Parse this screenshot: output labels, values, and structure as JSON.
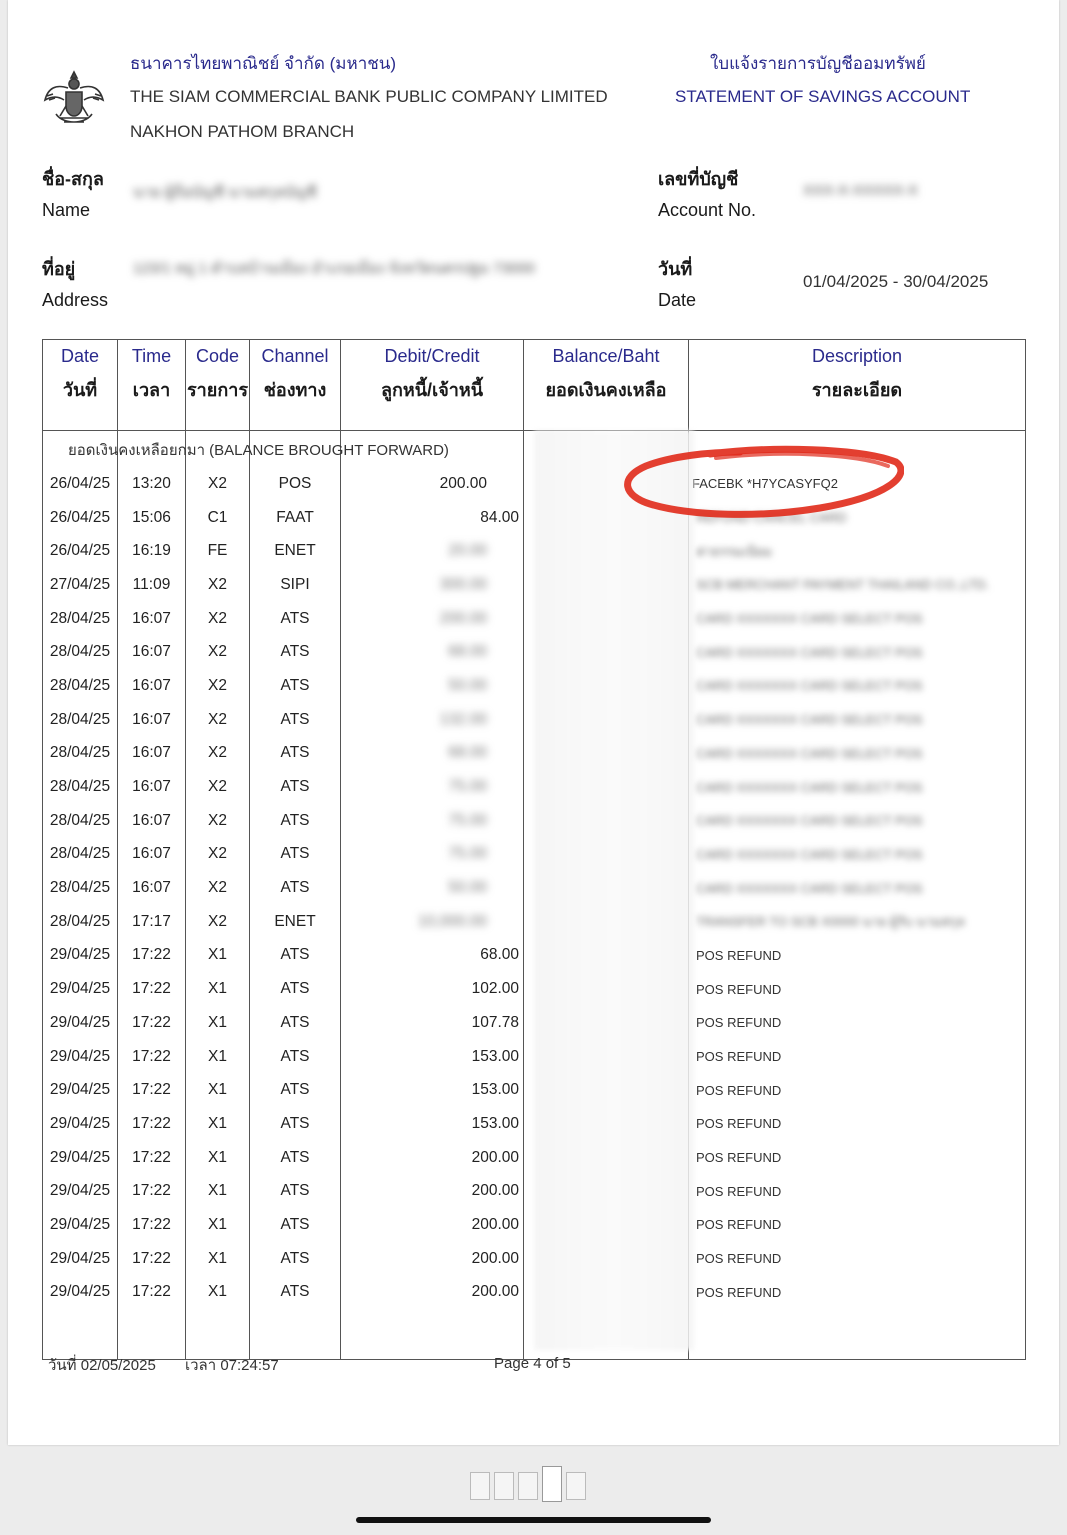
{
  "header": {
    "bank_th": "ธนาคารไทยพาณิชย์ จำกัด (มหาชน)",
    "bank_en": "THE SIAM COMMERCIAL BANK PUBLIC COMPANY LIMITED",
    "branch": "NAKHON PATHOM BRANCH",
    "doc_th": "ใบแจ้งรายการบัญชีออมทรัพย์",
    "doc_en": "STATEMENT OF SAVINGS ACCOUNT",
    "logo_icon": "garuda-emblem-icon"
  },
  "info": {
    "name_th": "ชื่อ-สกุล",
    "name_en": "Name",
    "name_value": "นาย ผู้ถือบัญชี นามสกุลบัญชี",
    "address_th": "ที่อยู่",
    "address_en": "Address",
    "address_value": "123/1 หมู่ 1 ตำบลบ้านเมือง อำเภอเมือง จังหวัดนครปฐม 73000",
    "account_th": "เลขที่บัญชี",
    "account_en": "Account No.",
    "account_value": "XXX-X-XXXXX-X",
    "date_th": "วันที่",
    "date_en": "Date",
    "date_value": "01/04/2025 - 30/04/2025"
  },
  "table": {
    "headers": [
      {
        "en": "Date",
        "th": "วันที่"
      },
      {
        "en": "Time",
        "th": "เวลา"
      },
      {
        "en": "Code",
        "th": "รายการ"
      },
      {
        "en": "Channel",
        "th": "ช่องทาง"
      },
      {
        "en": "Debit/Credit",
        "th": "ลูกหนี้/เจ้าหนี้"
      },
      {
        "en": "Balance/Baht",
        "th": "ยอดเงินคงเหลือ"
      },
      {
        "en": "Description",
        "th": "รายละเอียด"
      }
    ],
    "brought_forward": "ยอดเงินคงเหลือยกมา (BALANCE BROUGHT FORWARD)",
    "rows": [
      {
        "date": "26/04/25",
        "time": "13:20",
        "code": "X2",
        "channel": "POS",
        "amount": "200.00",
        "desc": "FACEBK *H7YCASYFQ2",
        "blur_amount": false,
        "blur_desc": false,
        "inset": true
      },
      {
        "date": "26/04/25",
        "time": "15:06",
        "code": "C1",
        "channel": "FAAT",
        "amount": "84.00",
        "desc": "REFUND CANCEL CARD",
        "blur_amount": false,
        "blur_desc": true
      },
      {
        "date": "26/04/25",
        "time": "16:19",
        "code": "FE",
        "channel": "ENET",
        "amount": "20.00",
        "desc": "ค่าธรรมเนียม",
        "blur_amount": true,
        "blur_desc": true
      },
      {
        "date": "27/04/25",
        "time": "11:09",
        "code": "X2",
        "channel": "SIPI",
        "amount": "300.00",
        "desc": "SCB MERCHANT PAYMENT THAILAND CO.,LTD.",
        "blur_amount": true,
        "blur_desc": true
      },
      {
        "date": "28/04/25",
        "time": "16:07",
        "code": "X2",
        "channel": "ATS",
        "amount": "200.00",
        "desc": "CARD XXXXXXX CARD SELECT POS",
        "blur_amount": true,
        "blur_desc": true
      },
      {
        "date": "28/04/25",
        "time": "16:07",
        "code": "X2",
        "channel": "ATS",
        "amount": "68.00",
        "desc": "CARD XXXXXXX CARD SELECT POS",
        "blur_amount": true,
        "blur_desc": true
      },
      {
        "date": "28/04/25",
        "time": "16:07",
        "code": "X2",
        "channel": "ATS",
        "amount": "50.00",
        "desc": "CARD XXXXXXX CARD SELECT POS",
        "blur_amount": true,
        "blur_desc": true
      },
      {
        "date": "28/04/25",
        "time": "16:07",
        "code": "X2",
        "channel": "ATS",
        "amount": "132.00",
        "desc": "CARD XXXXXXX CARD SELECT POS",
        "blur_amount": true,
        "blur_desc": true
      },
      {
        "date": "28/04/25",
        "time": "16:07",
        "code": "X2",
        "channel": "ATS",
        "amount": "68.00",
        "desc": "CARD XXXXXXX CARD SELECT POS",
        "blur_amount": true,
        "blur_desc": true
      },
      {
        "date": "28/04/25",
        "time": "16:07",
        "code": "X2",
        "channel": "ATS",
        "amount": "75.00",
        "desc": "CARD XXXXXXX CARD SELECT POS",
        "blur_amount": true,
        "blur_desc": true
      },
      {
        "date": "28/04/25",
        "time": "16:07",
        "code": "X2",
        "channel": "ATS",
        "amount": "75.00",
        "desc": "CARD XXXXXXX CARD SELECT POS",
        "blur_amount": true,
        "blur_desc": true
      },
      {
        "date": "28/04/25",
        "time": "16:07",
        "code": "X2",
        "channel": "ATS",
        "amount": "75.00",
        "desc": "CARD XXXXXXX CARD SELECT POS",
        "blur_amount": true,
        "blur_desc": true
      },
      {
        "date": "28/04/25",
        "time": "16:07",
        "code": "X2",
        "channel": "ATS",
        "amount": "50.00",
        "desc": "CARD XXXXXXX CARD SELECT POS",
        "blur_amount": true,
        "blur_desc": true
      },
      {
        "date": "28/04/25",
        "time": "17:17",
        "code": "X2",
        "channel": "ENET",
        "amount": "10,000.00",
        "desc": "TRANSFER TO SCB X0000 นาย ผู้รับ นามสกุล",
        "blur_amount": true,
        "blur_desc": true
      },
      {
        "date": "29/04/25",
        "time": "17:22",
        "code": "X1",
        "channel": "ATS",
        "amount": "68.00",
        "desc": "POS REFUND",
        "blur_amount": false,
        "blur_desc": false
      },
      {
        "date": "29/04/25",
        "time": "17:22",
        "code": "X1",
        "channel": "ATS",
        "amount": "102.00",
        "desc": "POS REFUND",
        "blur_amount": false,
        "blur_desc": false
      },
      {
        "date": "29/04/25",
        "time": "17:22",
        "code": "X1",
        "channel": "ATS",
        "amount": "107.78",
        "desc": "POS REFUND",
        "blur_amount": false,
        "blur_desc": false
      },
      {
        "date": "29/04/25",
        "time": "17:22",
        "code": "X1",
        "channel": "ATS",
        "amount": "153.00",
        "desc": "POS REFUND",
        "blur_amount": false,
        "blur_desc": false
      },
      {
        "date": "29/04/25",
        "time": "17:22",
        "code": "X1",
        "channel": "ATS",
        "amount": "153.00",
        "desc": "POS REFUND",
        "blur_amount": false,
        "blur_desc": false
      },
      {
        "date": "29/04/25",
        "time": "17:22",
        "code": "X1",
        "channel": "ATS",
        "amount": "153.00",
        "desc": "POS REFUND",
        "blur_amount": false,
        "blur_desc": false
      },
      {
        "date": "29/04/25",
        "time": "17:22",
        "code": "X1",
        "channel": "ATS",
        "amount": "200.00",
        "desc": "POS REFUND",
        "blur_amount": false,
        "blur_desc": false
      },
      {
        "date": "29/04/25",
        "time": "17:22",
        "code": "X1",
        "channel": "ATS",
        "amount": "200.00",
        "desc": "POS REFUND",
        "blur_amount": false,
        "blur_desc": false
      },
      {
        "date": "29/04/25",
        "time": "17:22",
        "code": "X1",
        "channel": "ATS",
        "amount": "200.00",
        "desc": "POS REFUND",
        "blur_amount": false,
        "blur_desc": false
      },
      {
        "date": "29/04/25",
        "time": "17:22",
        "code": "X1",
        "channel": "ATS",
        "amount": "200.00",
        "desc": "POS REFUND",
        "blur_amount": false,
        "blur_desc": false
      },
      {
        "date": "29/04/25",
        "time": "17:22",
        "code": "X1",
        "channel": "ATS",
        "amount": "200.00",
        "desc": "POS REFUND",
        "blur_amount": false,
        "blur_desc": false
      }
    ]
  },
  "footer": {
    "print_date": "วันที่ 02/05/2025",
    "print_time": "เวลา 07:24:57",
    "page": "Page 4 of 5"
  },
  "viewer": {
    "more_icon": "more-dots-icon",
    "thumbnail_count": 5,
    "current_thumbnail": 4
  },
  "colors": {
    "header_blue": "#2a2a8c",
    "annotation_red": "#e02a1a"
  }
}
